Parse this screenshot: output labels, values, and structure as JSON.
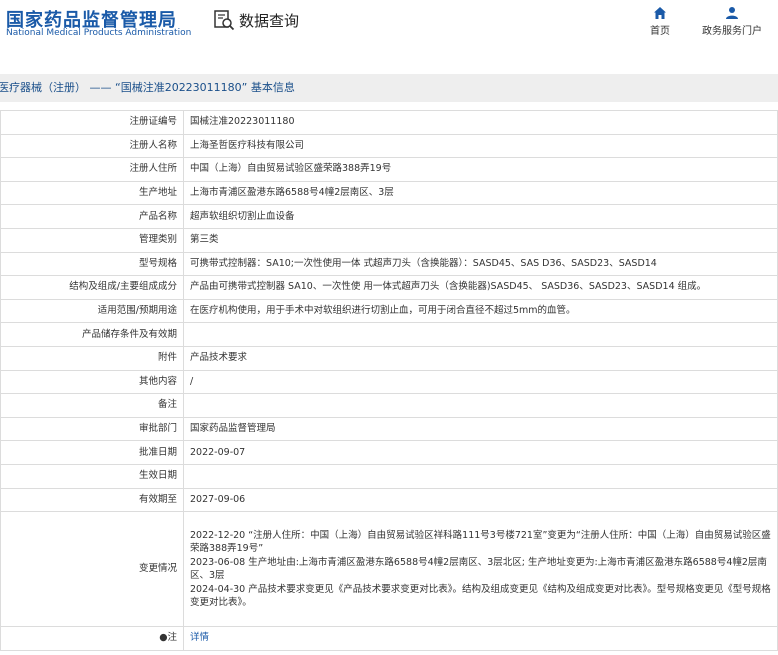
{
  "header": {
    "logo_cn": "国家药品监督管理局",
    "logo_en": "National Medical Products Administration",
    "search_title": "数据查询",
    "nav": [
      {
        "label": "首页",
        "icon": "home-icon"
      },
      {
        "label": "政务服务门户",
        "icon": "user-icon"
      }
    ]
  },
  "breadcrumb": "医疗器械（注册） —— “国械注准20223011180” 基本信息",
  "colors": {
    "brand": "#1a5aa8",
    "breadcrumb_bg": "#eeeeee",
    "border": "#dcdcdc"
  },
  "rows": [
    {
      "label": "注册证编号",
      "value": "国械注准20223011180"
    },
    {
      "label": "注册人名称",
      "value": "上海圣哲医疗科技有限公司"
    },
    {
      "label": "注册人住所",
      "value": "中国（上海）自由贸易试验区盛荣路388弄19号"
    },
    {
      "label": "生产地址",
      "value": "上海市青浦区盈港东路6588号4幢2层南区、3层"
    },
    {
      "label": "产品名称",
      "value": "超声软组织切割止血设备"
    },
    {
      "label": "管理类别",
      "value": "第三类"
    },
    {
      "label": "型号规格",
      "value": "可携带式控制器：SA10;一次性使用一体 式超声刀头（含换能器）：SASD45、SAS D36、SASD23、SASD14"
    },
    {
      "label": "结构及组成/主要组成成分",
      "value": "产品由可携带式控制器 SA10、一次性使 用一体式超声刀头（含换能器)SASD45、 SASD36、SASD23、SASD14 组成。"
    },
    {
      "label": "适用范围/预期用途",
      "value": "在医疗机构使用，用于手术中对软组织进行切割止血，可用于闭合直径不超过5mm的血管。"
    },
    {
      "label": "产品储存条件及有效期",
      "value": ""
    },
    {
      "label": "附件",
      "value": "产品技术要求"
    },
    {
      "label": "其他内容",
      "value": "/"
    },
    {
      "label": "备注",
      "value": ""
    },
    {
      "label": "审批部门",
      "value": "国家药品监督管理局"
    },
    {
      "label": "批准日期",
      "value": "2022-09-07"
    },
    {
      "label": "生效日期",
      "value": ""
    },
    {
      "label": "有效期至",
      "value": "2027-09-06"
    }
  ],
  "changes": {
    "label": "变更情况",
    "lines": [
      "2022-12-20 “注册人住所：中国（上海）自由贸易试验区祥科路111号3号楼721室”变更为“注册人住所：中国（上海）自由贸易试验区盛荣路388弄19号”",
      "2023-06-08 生产地址由:上海市青浦区盈港东路6588号4幢2层南区、3层北区; 生产地址变更为:上海市青浦区盈港东路6588号4幢2层南区、3层",
      "2024-04-30 产品技术要求变更见《产品技术要求变更对比表》。结构及组成变更见《结构及组成变更对比表》。型号规格变更见《型号规格变更对比表》。"
    ]
  },
  "note": {
    "label": "●注",
    "link": "详情"
  }
}
